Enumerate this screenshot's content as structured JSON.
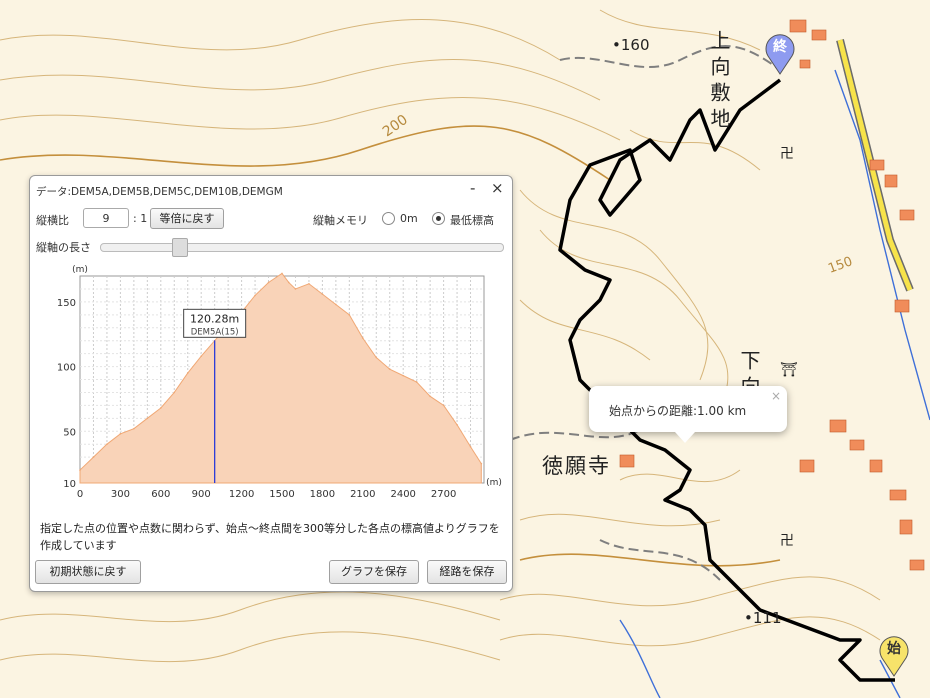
{
  "map": {
    "place_name": "徳願寺",
    "area_name_upper": "上向敷地",
    "area_name_lower": "下向地",
    "elevation_mark_top": "160",
    "elevation_mark_bottom": "111",
    "contour_label": "200",
    "contour_label_2": "150",
    "marker_end": "終",
    "marker_start": "始",
    "colors": {
      "route": "#000000",
      "contour": "#c9a05a",
      "road": "#8a8a8a",
      "building": "#e8743f",
      "highway": "#f7e34a",
      "river": "#3e6fd8"
    }
  },
  "popup": {
    "text": "始点からの距離:1.00 km",
    "close": "×"
  },
  "panel": {
    "data_label": "データ:DEM5A,DEM5B,DEM5C,DEM10B,DEMGM",
    "minimize": "-",
    "close": "×",
    "aspect_label": "縦横比",
    "aspect_value": "9",
    "aspect_suffix": ": 1",
    "reset_ratio_button": "等倍に戻す",
    "memory_label": "縦軸メモリ",
    "radio_0m": "0m",
    "radio_min": "最低標高",
    "axis_length_label": "縦軸の長さ",
    "axis_length_fraction": 0.18,
    "note": "指定した点の位置や点数に関わらず、始点～終点間を300等分した各点の標高値よりグラフを作成しています",
    "reset_button": "初期状態に戻す",
    "save_graph_button": "グラフを保存",
    "save_route_button": "経路を保存"
  },
  "chart_data": {
    "type": "area",
    "ylabel": "(m)",
    "xlabel": "(m)",
    "xlim": [
      0,
      3000
    ],
    "ylim": [
      10,
      170
    ],
    "xticks": [
      0,
      300,
      600,
      900,
      1200,
      1500,
      1800,
      2100,
      2400,
      2700
    ],
    "yticks": [
      10,
      50,
      100,
      150
    ],
    "x": [
      0,
      100,
      200,
      300,
      400,
      500,
      600,
      700,
      800,
      900,
      1000,
      1100,
      1200,
      1300,
      1400,
      1500,
      1550,
      1600,
      1700,
      1800,
      1900,
      2000,
      2100,
      2200,
      2300,
      2400,
      2500,
      2600,
      2700,
      2800,
      2900,
      2980
    ],
    "y": [
      20,
      30,
      40,
      48,
      52,
      60,
      68,
      80,
      95,
      108,
      120,
      132,
      142,
      155,
      165,
      172,
      165,
      160,
      164,
      156,
      148,
      140,
      122,
      107,
      98,
      93,
      88,
      77,
      70,
      55,
      38,
      25
    ],
    "tooltip": {
      "x": 1000,
      "label": "120.28m",
      "sublabel": "DEM5A(15)"
    },
    "colors": {
      "fill": "#f9d3b8",
      "stroke": "#f0a875",
      "marker_line": "#2b3bd8"
    }
  }
}
